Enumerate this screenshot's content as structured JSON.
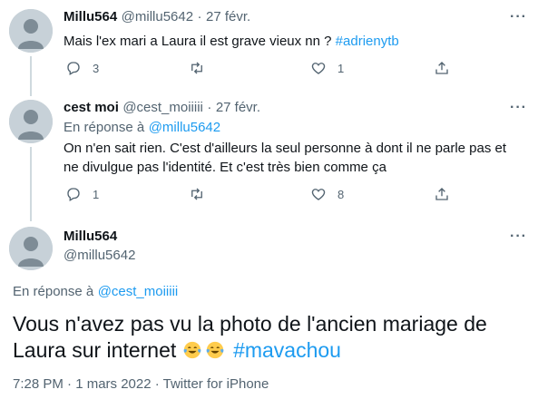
{
  "tweet1": {
    "name": "Millu564",
    "handle": "@millu5642",
    "date": "27 févr.",
    "text": "Mais l'ex mari a Laura il est grave vieux nn ?",
    "hashtag": "#adrienytb",
    "reply_count": "3",
    "like_count": "1"
  },
  "tweet2": {
    "name": "cest moi",
    "handle": "@cest_moiiiii",
    "date": "27 févr.",
    "reply_to_label": "En réponse à",
    "reply_to_handle": "@millu5642",
    "text_line1": "On n'en sait rien. C'est d'ailleurs la seul personne à dont il ne parle pas et",
    "text_line2": "ne divulgue pas l'identité. Et c'est très bien comme ça",
    "reply_count": "1",
    "like_count": "8"
  },
  "main_tweet": {
    "name": "Millu564",
    "handle": "@millu5642",
    "reply_to_label": "En réponse à",
    "reply_to_handle": "@cest_moiiiii",
    "text_line1": "Vous n'avez pas vu la photo de l'ancien mariage de",
    "text_line2": "Laura sur internet",
    "emojis": [
      "face-with-tears-of-joy",
      "face-with-tears-of-joy"
    ],
    "hashtag": "#mavachou",
    "meta": "7:28 PM · 1 mars 2022 · Twitter for iPhone"
  },
  "separator": "·",
  "more_label": "···",
  "colors": {
    "link": "#1d9bf0",
    "muted": "#536471",
    "text": "#0f1419"
  }
}
